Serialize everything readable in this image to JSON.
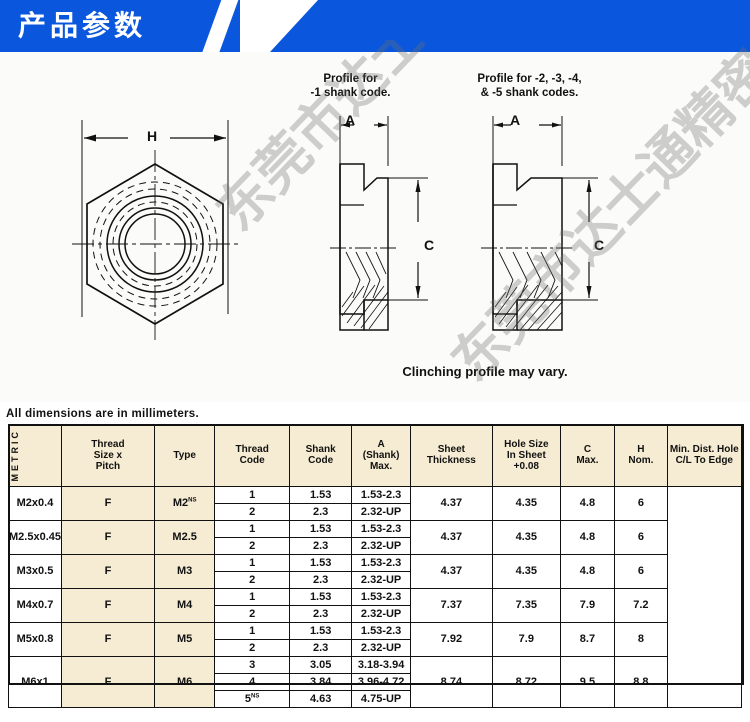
{
  "header": {
    "title": "产品参数",
    "accent_color": "#0a57dd"
  },
  "watermark": {
    "text": "东莞市达士通精密五金"
  },
  "diagram": {
    "caption_left_profile": "Profile for\n-1 shank code.",
    "caption_left_line1": "Profile for",
    "caption_left_line2": "-1 shank code.",
    "caption_right_line1": "Profile for -2, -3, -4,",
    "caption_right_line2": "& -5 shank codes.",
    "caption_bottom": "Clinching profile may vary.",
    "dim_h": "H",
    "dim_a_left": "A",
    "dim_a_right": "A",
    "dim_c_left": "C",
    "dim_c_right": "C"
  },
  "table": {
    "note": "All dimensions are in millimeters.",
    "row_group_label": "METRIC",
    "headers": [
      "Thread\nSize x\nPitch",
      "Type",
      "Thread\nCode",
      "Shank\nCode",
      "A\n(Shank)\nMax.",
      "Sheet\nThickness",
      "Hole Size\nIn Sheet\n+0.08",
      "C\nMax.",
      "H\nNom.",
      "Min. Dist. Hole\nC/L To Edge"
    ],
    "headers_lines": [
      [
        "Thread",
        "Size x",
        "Pitch"
      ],
      [
        "Type"
      ],
      [
        "Thread",
        "Code"
      ],
      [
        "Shank",
        "Code"
      ],
      [
        "A",
        "(Shank)",
        "Max."
      ],
      [
        "Sheet",
        "Thickness"
      ],
      [
        "Hole Size",
        "In Sheet",
        "+0.08"
      ],
      [
        "C",
        "Max."
      ],
      [
        "H",
        "Nom."
      ],
      [
        "Min. Dist. Hole",
        "C/L To Edge"
      ]
    ],
    "rows": [
      {
        "thread_size": "M2x0.4",
        "type": "F",
        "thread_code": "M2",
        "thread_code_sup": "NS",
        "hole_size": "4.37",
        "c_max": "4.35",
        "h_nom": "4.8",
        "min_dist": "6",
        "shanks": [
          {
            "code": "1",
            "code_sup": "",
            "a_max": "1.53",
            "sheet_thickness": "1.53-2.3"
          },
          {
            "code": "2",
            "code_sup": "",
            "a_max": "2.3",
            "sheet_thickness": "2.32-UP"
          }
        ]
      },
      {
        "thread_size": "M2.5x0.45",
        "type": "F",
        "thread_code": "M2.5",
        "thread_code_sup": "",
        "hole_size": "4.37",
        "c_max": "4.35",
        "h_nom": "4.8",
        "min_dist": "6",
        "shanks": [
          {
            "code": "1",
            "code_sup": "",
            "a_max": "1.53",
            "sheet_thickness": "1.53-2.3"
          },
          {
            "code": "2",
            "code_sup": "",
            "a_max": "2.3",
            "sheet_thickness": "2.32-UP"
          }
        ]
      },
      {
        "thread_size": "M3x0.5",
        "type": "F",
        "thread_code": "M3",
        "thread_code_sup": "",
        "hole_size": "4.37",
        "c_max": "4.35",
        "h_nom": "4.8",
        "min_dist": "6",
        "shanks": [
          {
            "code": "1",
            "code_sup": "",
            "a_max": "1.53",
            "sheet_thickness": "1.53-2.3"
          },
          {
            "code": "2",
            "code_sup": "",
            "a_max": "2.3",
            "sheet_thickness": "2.32-UP"
          }
        ]
      },
      {
        "thread_size": "M4x0.7",
        "type": "F",
        "thread_code": "M4",
        "thread_code_sup": "",
        "hole_size": "7.37",
        "c_max": "7.35",
        "h_nom": "7.9",
        "min_dist": "7.2",
        "shanks": [
          {
            "code": "1",
            "code_sup": "",
            "a_max": "1.53",
            "sheet_thickness": "1.53-2.3"
          },
          {
            "code": "2",
            "code_sup": "",
            "a_max": "2.3",
            "sheet_thickness": "2.32-UP"
          }
        ]
      },
      {
        "thread_size": "M5x0.8",
        "type": "F",
        "thread_code": "M5",
        "thread_code_sup": "",
        "hole_size": "7.92",
        "c_max": "7.9",
        "h_nom": "8.7",
        "min_dist": "8",
        "shanks": [
          {
            "code": "1",
            "code_sup": "",
            "a_max": "1.53",
            "sheet_thickness": "1.53-2.3"
          },
          {
            "code": "2",
            "code_sup": "",
            "a_max": "2.3",
            "sheet_thickness": "2.32-UP"
          }
        ]
      },
      {
        "thread_size": "M6x1",
        "type": "F",
        "thread_code": "M6",
        "thread_code_sup": "",
        "hole_size": "8.74",
        "c_max": "8.72",
        "h_nom": "9.5",
        "min_dist": "8.8",
        "shanks": [
          {
            "code": "3",
            "code_sup": "",
            "a_max": "3.05",
            "sheet_thickness": "3.18-3.94"
          },
          {
            "code": "4",
            "code_sup": "",
            "a_max": "3.84",
            "sheet_thickness": "3.96-4.72"
          },
          {
            "code": "5",
            "code_sup": "NS",
            "a_max": "4.63",
            "sheet_thickness": "4.75-UP"
          }
        ]
      }
    ]
  }
}
